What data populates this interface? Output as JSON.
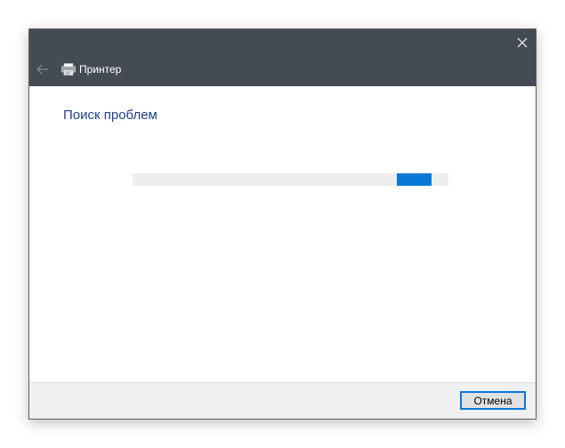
{
  "window": {
    "title": "Принтер",
    "icons": {
      "back": "back-arrow-icon",
      "close": "close-icon",
      "app": "printer-icon"
    }
  },
  "content": {
    "heading": "Поиск проблем",
    "progress": {
      "mode": "indeterminate",
      "value_percent": null,
      "colors": {
        "track": "#eeeeee",
        "fill": "#0a78d7"
      }
    }
  },
  "footer": {
    "cancel_label": "Отмена"
  },
  "colors": {
    "titlebar": "#454b55",
    "heading": "#1d3f8a",
    "accent": "#0a78d7"
  }
}
